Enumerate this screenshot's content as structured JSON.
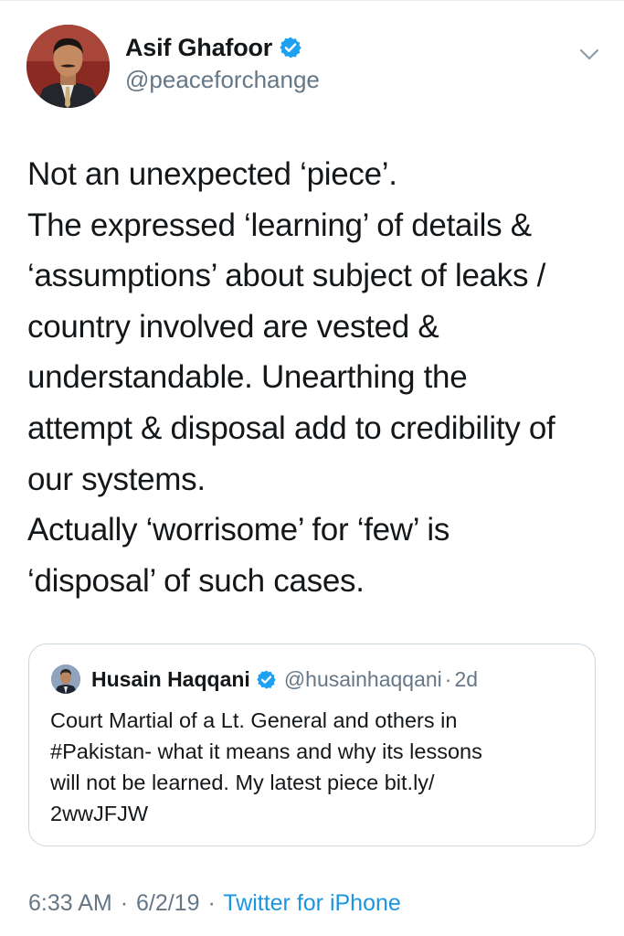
{
  "tweet": {
    "author_name": "Asif Ghafoor",
    "author_handle": "@peaceforchange",
    "verified": true,
    "text_lines": [
      "Not an unexpected ‘piece’.",
      "The expressed ‘learning’ of details &",
      "‘assumptions’ about subject of leaks /",
      "country involved are vested &",
      "understandable. Unearthing the",
      "attempt & disposal add to credibility of",
      "our systems.",
      "Actually ‘worrisome’ for ‘few’ is",
      "‘disposal’ of such cases."
    ],
    "time": "6:33 AM",
    "date": "6/2/19",
    "source": "Twitter for iPhone",
    "separator": "·",
    "menu_icon": "chevron-down-icon"
  },
  "quoted_tweet": {
    "author_name": "Husain Haqqani",
    "author_handle": "@husainhaqqani",
    "separator": "·",
    "age": "2d",
    "verified": true,
    "text_lines": [
      "Court Martial of a Lt. General and others in",
      "#Pakistan- what it means and why its lessons",
      "will not be learned. My latest piece bit.ly/",
      "2wwJFJW"
    ]
  },
  "colors": {
    "text": "#14171a",
    "secondary": "#657786",
    "link": "#1b95e0",
    "verified": "#1da1f2",
    "border": "#ccd6dd"
  }
}
